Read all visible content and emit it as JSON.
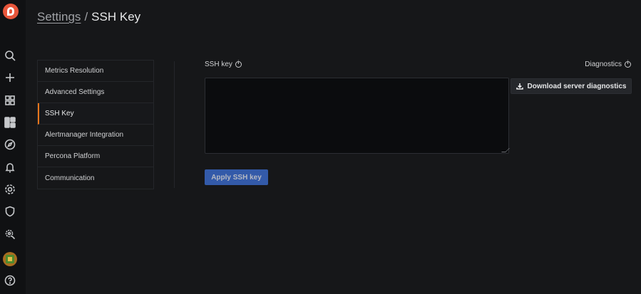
{
  "breadcrumb": {
    "parent": "Settings",
    "separator": "/",
    "current": "SSH Key"
  },
  "tabs": [
    {
      "label": "Metrics Resolution"
    },
    {
      "label": "Advanced Settings"
    },
    {
      "label": "SSH Key",
      "active": true
    },
    {
      "label": "Alertmanager Integration"
    },
    {
      "label": "Percona Platform"
    },
    {
      "label": "Communication"
    }
  ],
  "ssh": {
    "label": "SSH key",
    "value": "",
    "apply_label": "Apply SSH key"
  },
  "diagnostics": {
    "label": "Diagnostics",
    "button_label": "Download server diagnostics"
  },
  "nav_icons": [
    "search-icon",
    "plus-icon",
    "dashboards-icon",
    "panels-icon",
    "explore-icon",
    "alert-bell-icon",
    "gear-icon",
    "shield-icon",
    "inventory-icon",
    "help-icon"
  ],
  "colors": {
    "accent": "#f0761b",
    "primary_button": "#3d71d9",
    "background": "#161719"
  }
}
